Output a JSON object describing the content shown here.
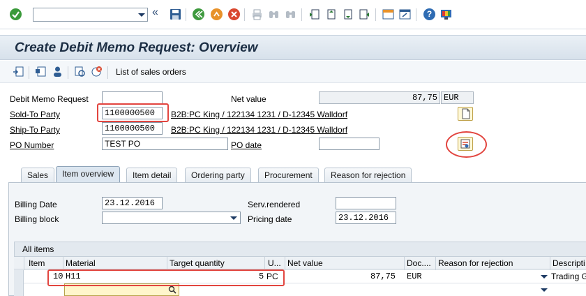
{
  "toolbar": {
    "command_field_value": "",
    "icons": [
      "enter-check-icon",
      "history-arrows-icon",
      "save-icon",
      "back-icon",
      "exit-icon",
      "cancel-icon",
      "print-icon",
      "find-icon",
      "find-next-icon",
      "first-page-icon",
      "previous-page-icon",
      "next-page-icon",
      "last-page-icon",
      "create-session-icon",
      "create-shortcut-icon",
      "help-icon",
      "customize-layout-icon"
    ]
  },
  "title": "Create Debit Memo Request: Overview",
  "app_toolbar": {
    "list_label": "List of sales orders"
  },
  "header": {
    "debit_memo_request_label": "Debit Memo Request",
    "debit_memo_request_value": "",
    "net_value_label": "Net value",
    "net_value": "87,75",
    "currency": "EUR",
    "sold_to_label": "Sold-To Party",
    "sold_to_value": "1100000500",
    "sold_to_text": "B2B:PC King / 122134 1231 / D-12345 Walldorf",
    "ship_to_label": "Ship-To Party",
    "ship_to_value": "1100000500",
    "ship_to_text": "B2B:PC King / 122134 1231 / D-12345 Walldorf",
    "po_number_label": "PO Number",
    "po_number_value": "TEST PO",
    "po_date_label": "PO date",
    "po_date_value": ""
  },
  "tabs": [
    {
      "label": "Sales",
      "active": false
    },
    {
      "label": "Item overview",
      "active": true
    },
    {
      "label": "Item detail",
      "active": false
    },
    {
      "label": "Ordering party",
      "active": false
    },
    {
      "label": "Procurement",
      "active": false
    },
    {
      "label": "Reason for rejection",
      "active": false
    }
  ],
  "item_overview": {
    "billing_date_label": "Billing Date",
    "billing_date_value": "23.12.2016",
    "serv_rendered_label": "Serv.rendered",
    "serv_rendered_value": "",
    "billing_block_label": "Billing block",
    "billing_block_value": "",
    "pricing_date_label": "Pricing date",
    "pricing_date_value": "23.12.2016"
  },
  "table": {
    "title": "All items",
    "columns": [
      "Item",
      "Material",
      "Target quantity",
      "U...",
      "Net value",
      "Doc....",
      "Reason for rejection",
      "Descripti"
    ],
    "rows": [
      {
        "item": "10",
        "material": "H11",
        "quantity": "5",
        "unit": "PC",
        "net_value": "87,75",
        "currency": "EUR",
        "reason": "",
        "description": "Trading G"
      }
    ]
  },
  "colors": {
    "title_text": "#1c2e44",
    "highlight": "#e2453f",
    "accent": "#1d3a63"
  }
}
